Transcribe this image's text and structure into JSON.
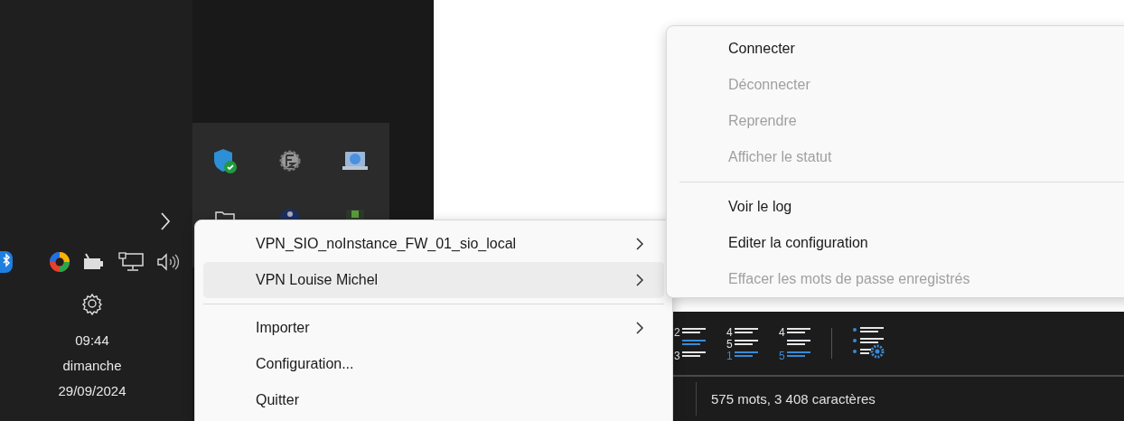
{
  "taskbar": {
    "tray_icons": [
      {
        "kind": "bluetooth"
      },
      {
        "kind": "browser"
      },
      {
        "kind": "battery"
      },
      {
        "kind": "network"
      },
      {
        "kind": "speaker"
      }
    ],
    "clock": {
      "time": "09:44",
      "day": "dimanche",
      "date": "29/09/2024"
    }
  },
  "tray_overflow": {
    "icons": [
      {
        "kind": "shield"
      },
      {
        "kind": "ftp"
      },
      {
        "kind": "laptop"
      },
      {
        "kind": "folder"
      },
      {
        "kind": "globe"
      },
      {
        "kind": "app"
      }
    ]
  },
  "context_menu": {
    "items": [
      {
        "kind": "item",
        "label": "VPN_SIO_noInstance_FW_01_sio_local",
        "submenu": true,
        "selected": false
      },
      {
        "kind": "item",
        "label": "VPN Louise Michel",
        "submenu": true,
        "selected": true
      },
      {
        "kind": "separator"
      },
      {
        "kind": "item",
        "label": "Importer",
        "submenu": true,
        "selected": false
      },
      {
        "kind": "item",
        "label": "Configuration...",
        "submenu": false,
        "selected": false
      },
      {
        "kind": "item",
        "label": "Quitter",
        "submenu": false,
        "selected": false
      }
    ]
  },
  "submenu": {
    "items": [
      {
        "kind": "item",
        "label": "Connecter",
        "disabled": false
      },
      {
        "kind": "item",
        "label": "Déconnecter",
        "disabled": true
      },
      {
        "kind": "item",
        "label": "Reprendre",
        "disabled": true
      },
      {
        "kind": "item",
        "label": "Afficher le statut",
        "disabled": true
      },
      {
        "kind": "separator"
      },
      {
        "kind": "item",
        "label": "Voir le log",
        "disabled": false
      },
      {
        "kind": "item",
        "label": "Editer la configuration",
        "disabled": false
      },
      {
        "kind": "item",
        "label": "Effacer les mots de passe enregistrés",
        "disabled": true
      }
    ]
  },
  "editor": {
    "toolbar": [
      {
        "kind": "numbered",
        "lines": [
          {
            "num": "2",
            "accent": false
          },
          {
            "accent": true
          },
          {
            "num": "3",
            "accent": false
          }
        ]
      },
      {
        "kind": "numbered",
        "lines": [
          {
            "num": "4",
            "accent": false
          },
          {
            "num": "5",
            "accent": false
          },
          {
            "num": "1",
            "accent": true
          }
        ]
      },
      {
        "kind": "numbered",
        "lines": [
          {
            "num": "4",
            "accent": false
          },
          {
            "accent": false
          },
          {
            "num": "5",
            "accent": true
          }
        ]
      },
      {
        "kind": "divider"
      },
      {
        "kind": "bullets-settings"
      }
    ],
    "status": "575 mots, 3 408 caractères"
  }
}
